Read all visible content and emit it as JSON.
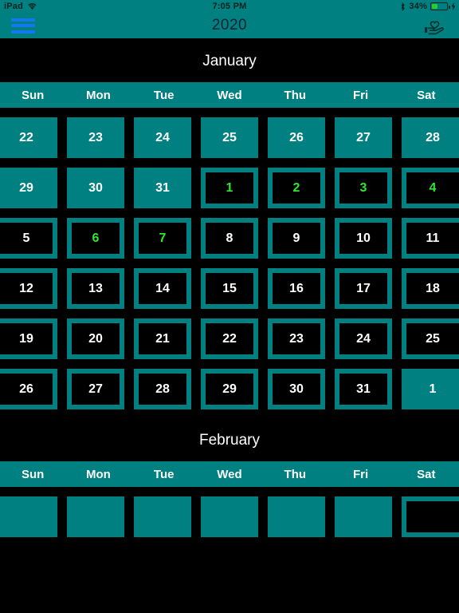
{
  "status_bar": {
    "device": "iPad",
    "wifi_icon": "wifi-icon",
    "time": "7:05 PM",
    "bluetooth_icon": "bluetooth-icon",
    "battery_percent": "34%",
    "battery_level": 34,
    "charging_icon": "lightning-bolt-icon",
    "battery_fill_color": "#29cc29"
  },
  "nav_bar": {
    "menu_icon": "hamburger-menu-icon",
    "title": "2020",
    "right_icon": "hand-holding-heart-icon",
    "background_color": "#008080",
    "menu_icon_color": "#1477f0"
  },
  "theme": {
    "background": "#000000",
    "accent": "#008080",
    "marked_text": "#2fe82f",
    "text": "#ffffff"
  },
  "weekdays": [
    "Sun",
    "Mon",
    "Tue",
    "Wed",
    "Thu",
    "Fri",
    "Sat"
  ],
  "months": [
    {
      "name": "January",
      "weeks": [
        [
          {
            "day": "22",
            "style": "filled",
            "marked": false
          },
          {
            "day": "23",
            "style": "filled",
            "marked": false
          },
          {
            "day": "24",
            "style": "filled",
            "marked": false
          },
          {
            "day": "25",
            "style": "filled",
            "marked": false
          },
          {
            "day": "26",
            "style": "filled",
            "marked": false
          },
          {
            "day": "27",
            "style": "filled",
            "marked": false
          },
          {
            "day": "28",
            "style": "filled",
            "marked": false
          }
        ],
        [
          {
            "day": "29",
            "style": "filled",
            "marked": false
          },
          {
            "day": "30",
            "style": "filled",
            "marked": false
          },
          {
            "day": "31",
            "style": "filled",
            "marked": false
          },
          {
            "day": "1",
            "style": "outlined",
            "marked": true
          },
          {
            "day": "2",
            "style": "outlined",
            "marked": true
          },
          {
            "day": "3",
            "style": "outlined",
            "marked": true
          },
          {
            "day": "4",
            "style": "outlined",
            "marked": true
          }
        ],
        [
          {
            "day": "5",
            "style": "outlined",
            "marked": false
          },
          {
            "day": "6",
            "style": "outlined",
            "marked": true
          },
          {
            "day": "7",
            "style": "outlined",
            "marked": true
          },
          {
            "day": "8",
            "style": "outlined",
            "marked": false
          },
          {
            "day": "9",
            "style": "outlined",
            "marked": false
          },
          {
            "day": "10",
            "style": "outlined",
            "marked": false
          },
          {
            "day": "11",
            "style": "outlined",
            "marked": false
          }
        ],
        [
          {
            "day": "12",
            "style": "outlined",
            "marked": false
          },
          {
            "day": "13",
            "style": "outlined",
            "marked": false
          },
          {
            "day": "14",
            "style": "outlined",
            "marked": false
          },
          {
            "day": "15",
            "style": "outlined",
            "marked": false
          },
          {
            "day": "16",
            "style": "outlined",
            "marked": false
          },
          {
            "day": "17",
            "style": "outlined",
            "marked": false
          },
          {
            "day": "18",
            "style": "outlined",
            "marked": false
          }
        ],
        [
          {
            "day": "19",
            "style": "outlined",
            "marked": false
          },
          {
            "day": "20",
            "style": "outlined",
            "marked": false
          },
          {
            "day": "21",
            "style": "outlined",
            "marked": false
          },
          {
            "day": "22",
            "style": "outlined",
            "marked": false
          },
          {
            "day": "23",
            "style": "outlined",
            "marked": false
          },
          {
            "day": "24",
            "style": "outlined",
            "marked": false
          },
          {
            "day": "25",
            "style": "outlined",
            "marked": false
          }
        ],
        [
          {
            "day": "26",
            "style": "outlined",
            "marked": false
          },
          {
            "day": "27",
            "style": "outlined",
            "marked": false
          },
          {
            "day": "28",
            "style": "outlined",
            "marked": false
          },
          {
            "day": "29",
            "style": "outlined",
            "marked": false
          },
          {
            "day": "30",
            "style": "outlined",
            "marked": false
          },
          {
            "day": "31",
            "style": "outlined",
            "marked": false
          },
          {
            "day": "1",
            "style": "filled",
            "marked": false
          }
        ]
      ]
    },
    {
      "name": "February",
      "weeks": [
        [
          {
            "day": "",
            "style": "filled",
            "marked": false
          },
          {
            "day": "",
            "style": "filled",
            "marked": false
          },
          {
            "day": "",
            "style": "filled",
            "marked": false
          },
          {
            "day": "",
            "style": "filled",
            "marked": false
          },
          {
            "day": "",
            "style": "filled",
            "marked": false
          },
          {
            "day": "",
            "style": "filled",
            "marked": false
          },
          {
            "day": "",
            "style": "outlined",
            "marked": false
          }
        ]
      ]
    }
  ]
}
